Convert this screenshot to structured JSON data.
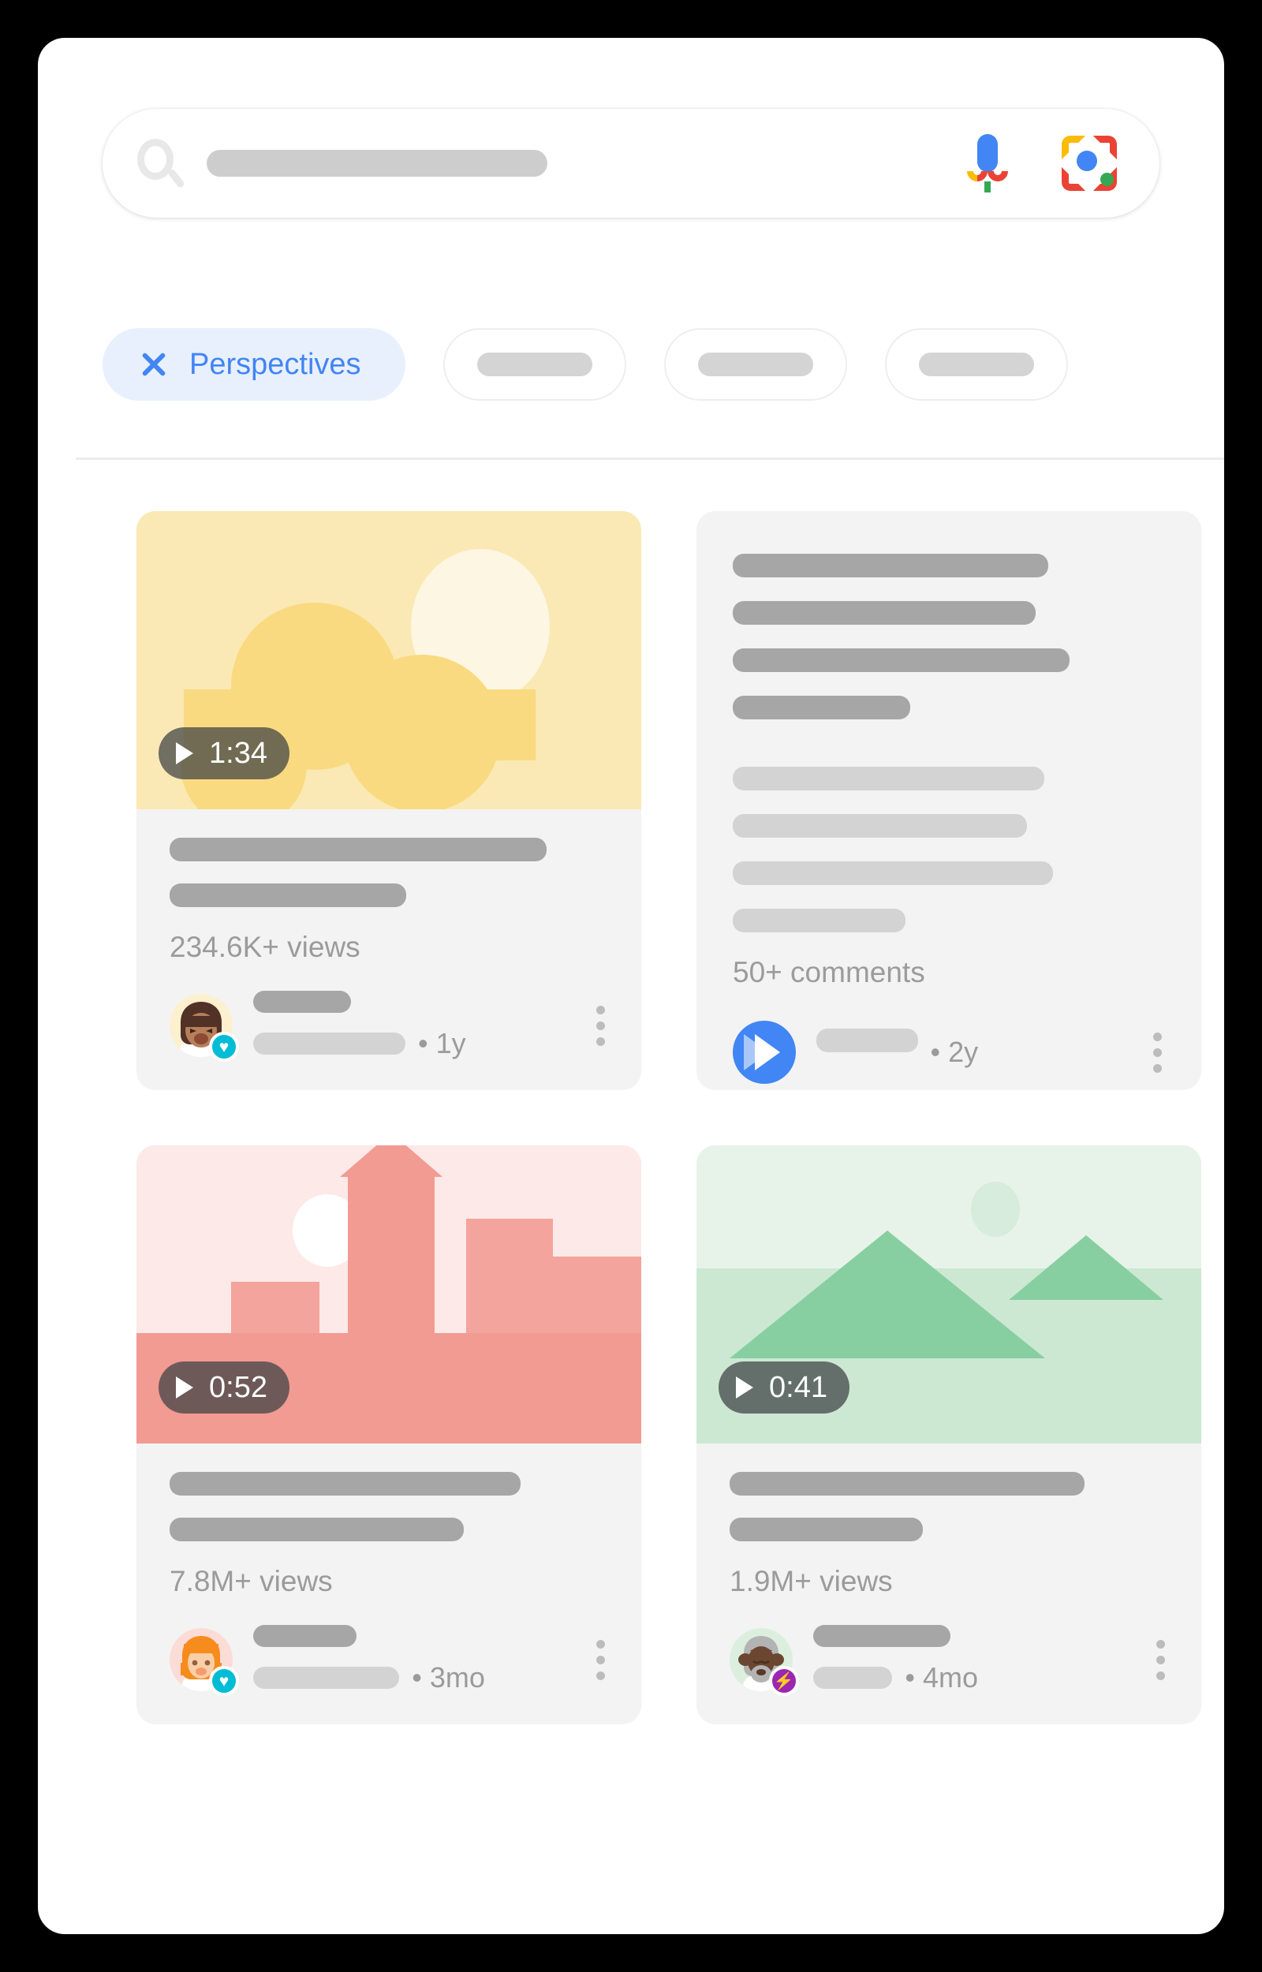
{
  "search": {
    "magnifier_icon": "search-icon",
    "query_value": "",
    "mic_icon": "microphone-icon",
    "lens_icon": "google-lens-icon"
  },
  "filters": {
    "active_chip": {
      "label": "Perspectives",
      "close_icon": "close-icon",
      "accent_color": "#4285f4",
      "background_color": "#e8f0fe"
    },
    "placeholder_chips": [
      {
        "label": ""
      },
      {
        "label": ""
      },
      {
        "label": ""
      }
    ]
  },
  "results": [
    {
      "type": "video",
      "thumbnail": "sun-and-clouds-illustration",
      "duration": "1:34",
      "play_icon": "play-icon",
      "stat": "234.6K+ views",
      "avatar": "woman-avatar",
      "badge_icon": "heart-badge-icon",
      "badge_color": "#00bcd4",
      "age": "• 1y",
      "menu_icon": "more-options-icon"
    },
    {
      "type": "discussion",
      "stat": "50+ comments",
      "avatar": "forum-icon",
      "badge_icon": "",
      "badge_color": "#4285f4",
      "age": "• 2y",
      "menu_icon": "more-options-icon"
    },
    {
      "type": "video",
      "thumbnail": "city-skyline-illustration",
      "duration": "0:52",
      "play_icon": "play-icon",
      "stat": "7.8M+ views",
      "avatar": "orange-hair-avatar",
      "badge_icon": "heart-badge-icon",
      "badge_color": "#00bcd4",
      "age": "• 3mo",
      "menu_icon": "more-options-icon"
    },
    {
      "type": "video",
      "thumbnail": "green-mountains-illustration",
      "duration": "0:41",
      "play_icon": "play-icon",
      "stat": "1.9M+ views",
      "avatar": "bull-avatar",
      "badge_icon": "lightning-badge-icon",
      "badge_color": "#9c27b0",
      "age": "• 4mo",
      "menu_icon": "more-options-icon"
    }
  ]
}
